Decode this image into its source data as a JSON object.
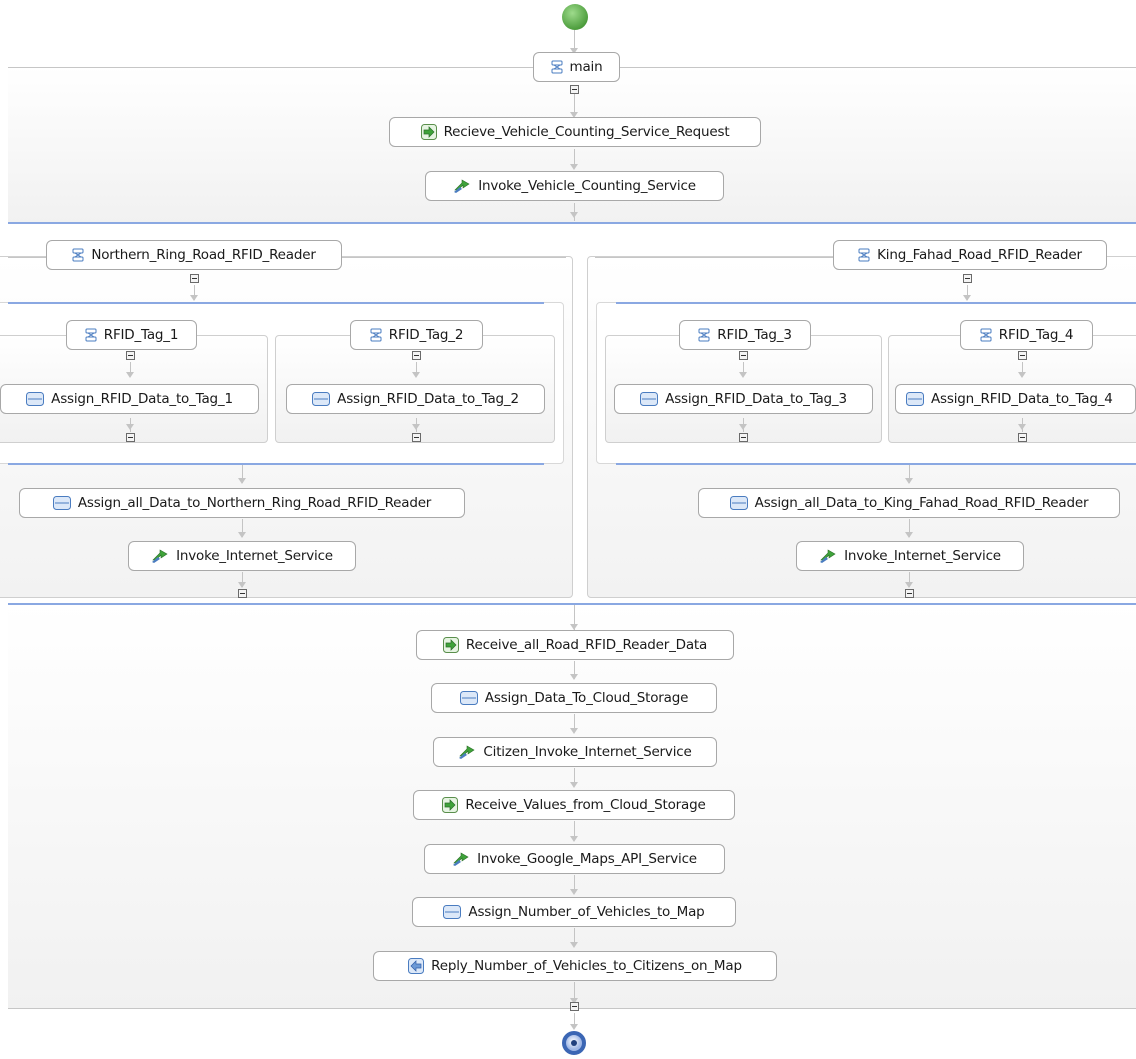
{
  "process": {
    "scope": "main",
    "receive_request": "Recieve_Vehicle_Counting_Service_Request",
    "invoke_counting": "Invoke_Vehicle_Counting_Service",
    "northern": {
      "scope": "Northern_Ring_Road_RFID_Reader",
      "tag1": "RFID_Tag_1",
      "tag2": "RFID_Tag_2",
      "assign1": "Assign_RFID_Data_to_Tag_1",
      "assign2": "Assign_RFID_Data_to_Tag_2",
      "assign_all": "Assign_all_Data_to_Northern_Ring_Road_RFID_Reader",
      "invoke": "Invoke_Internet_Service"
    },
    "king_fahad": {
      "scope": "King_Fahad_Road_RFID_Reader",
      "tag3": "RFID_Tag_3",
      "tag4": "RFID_Tag_4",
      "assign3": "Assign_RFID_Data_to_Tag_3",
      "assign4": "Assign_RFID_Data_to_Tag_4",
      "assign_all": "Assign_all_Data_to_King_Fahad_Road_RFID_Reader",
      "invoke": "Invoke_Internet_Service"
    },
    "receive_all": "Receive_all_Road_RFID_Reader_Data",
    "assign_cloud": "Assign_Data_To_Cloud_Storage",
    "citizen_invoke": "Citizen_Invoke_Internet_Service",
    "receive_values": "Receive_Values_from_Cloud_Storage",
    "invoke_maps": "Invoke_Google_Maps_API_Service",
    "assign_map": "Assign_Number_of_Vehicles_to_Map",
    "reply": "Reply_Number_of_Vehicles_to_Citizens_on_Map"
  },
  "icons": {
    "scope": "scope-icon",
    "receive": "receive-icon",
    "invoke": "invoke-icon",
    "assign": "assign-icon",
    "reply": "reply-icon"
  },
  "colors": {
    "start": "#5aa64a",
    "end": "#2f5da8",
    "flow_divider": "#8aa8e2"
  }
}
